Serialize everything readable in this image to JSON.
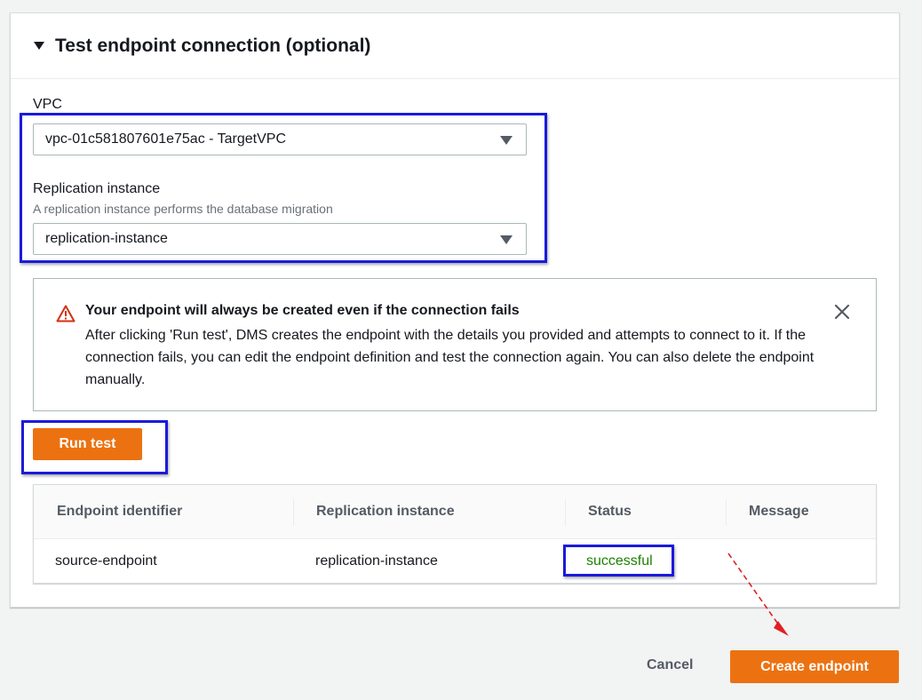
{
  "section": {
    "title": "Test endpoint connection (optional)"
  },
  "vpc": {
    "label": "VPC",
    "value": "vpc-01c581807601e75ac - TargetVPC"
  },
  "replication": {
    "label": "Replication instance",
    "description": "A replication instance performs the database migration",
    "value": "replication-instance"
  },
  "alert": {
    "title": "Your endpoint will always be created even if the connection fails",
    "body": "After clicking 'Run test', DMS creates the endpoint with the details you provided and attempts to connect to it. If the connection fails, you can edit the endpoint definition and test the connection again. You can also delete the endpoint manually.",
    "icon": "warning-icon",
    "color": "#d13212"
  },
  "run_test": {
    "label": "Run test"
  },
  "table": {
    "columns": [
      "Endpoint identifier",
      "Replication instance",
      "Status",
      "Message"
    ],
    "rows": [
      {
        "endpoint": "source-endpoint",
        "replication_instance": "replication-instance",
        "status": "successful",
        "message": ""
      }
    ]
  },
  "footer": {
    "cancel_label": "Cancel",
    "create_label": "Create endpoint"
  },
  "colors": {
    "accent": "#ec7211",
    "success": "#1d8102",
    "highlight": "#1a1adb",
    "annotation_arrow": "#e02020"
  }
}
